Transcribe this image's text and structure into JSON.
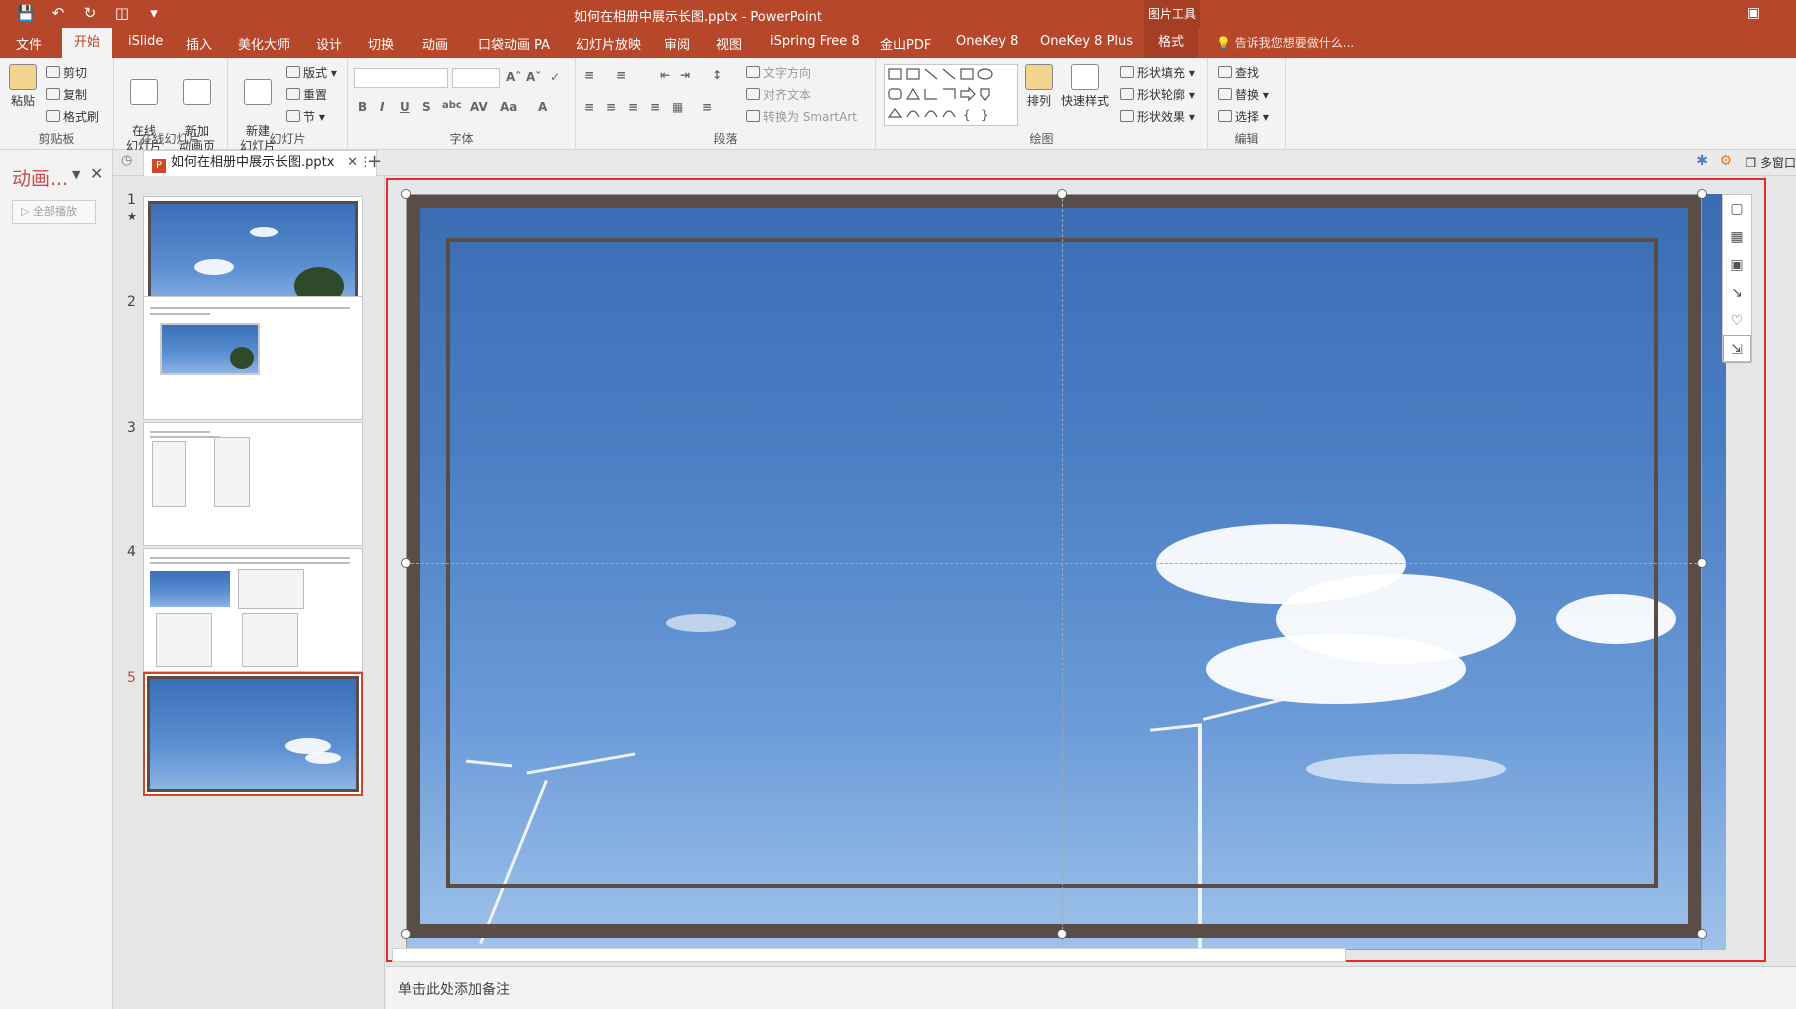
{
  "window": {
    "title": "如何在相册中展示长图.pptx - PowerPoint",
    "context_group": "图片工具"
  },
  "qat_icons": [
    "save-icon",
    "undo-icon",
    "redo-icon",
    "present-icon",
    "customize-icon"
  ],
  "tabs": [
    {
      "label": "文件"
    },
    {
      "label": "开始"
    },
    {
      "label": "iSlide"
    },
    {
      "label": "插入"
    },
    {
      "label": "美化大师"
    },
    {
      "label": "设计"
    },
    {
      "label": "切换"
    },
    {
      "label": "动画"
    },
    {
      "label": "口袋动画 PA"
    },
    {
      "label": "幻灯片放映"
    },
    {
      "label": "审阅"
    },
    {
      "label": "视图"
    },
    {
      "label": "iSpring Free 8"
    },
    {
      "label": "金山PDF"
    },
    {
      "label": "OneKey 8"
    },
    {
      "label": "OneKey 8 Plus"
    },
    {
      "label": "格式"
    }
  ],
  "active_tab": "开始",
  "tell_me": "告诉我您想要做什么...",
  "ribbon": {
    "clipboard": {
      "paste": "粘贴",
      "cut": "剪切",
      "copy": "复制",
      "format_painter": "格式刷",
      "label": "剪贴板"
    },
    "online": {
      "online_slide": "在线\n幻灯片",
      "new_anim": "新加\n动画页",
      "label": "在线幻灯片"
    },
    "slides": {
      "new_slide": "新建\n幻灯片",
      "layout": "版式",
      "reset": "重置",
      "section": "节",
      "label": "幻灯片"
    },
    "font": {
      "label": "字体"
    },
    "paragraph": {
      "text_direction": "文字方向",
      "align_text": "对齐文本",
      "smartart": "转换为 SmartArt",
      "label": "段落"
    },
    "drawing": {
      "arrange": "排列",
      "quick_styles": "快速样式",
      "fill": "形状填充",
      "outline": "形状轮廓",
      "effects": "形状效果",
      "label": "绘图"
    },
    "editing": {
      "find": "查找",
      "replace": "替换",
      "select": "选择",
      "label": "编辑"
    }
  },
  "anim_pane": {
    "title": "动画...",
    "play_all": "全部播放"
  },
  "doc_tab": {
    "name": "如何在相册中展示长图.pptx",
    "multi_window": "多窗口"
  },
  "slides": [
    {
      "number": "1",
      "starred": true
    },
    {
      "number": "2"
    },
    {
      "number": "3"
    },
    {
      "number": "4"
    },
    {
      "number": "5",
      "current": true
    }
  ],
  "notes_placeholder": "单击此处添加备注",
  "colors": {
    "accent": "#b7472a",
    "frame": "#5a4c46",
    "selection": "#e32b2b"
  }
}
